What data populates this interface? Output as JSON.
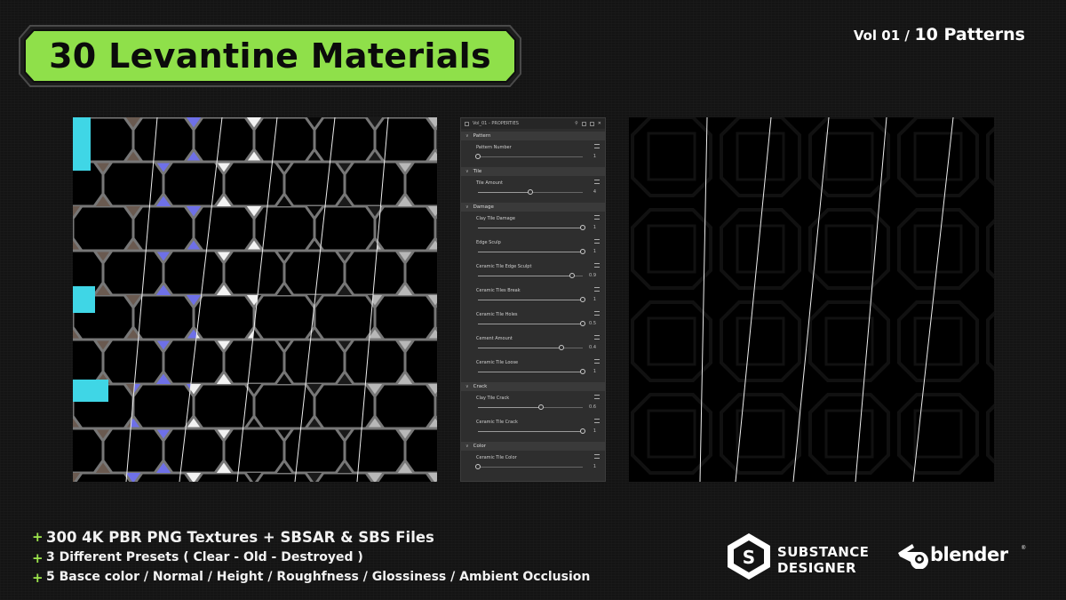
{
  "title": "30 Levantine Materials",
  "volume": {
    "vol": "Vol 01 /",
    "patterns": "10 Patterns"
  },
  "panel": {
    "header": "Vol_01 - PROPERTIES",
    "sections": [
      {
        "name": "Pattern",
        "params": [
          {
            "label": "Pattern Number",
            "value": "1",
            "level": 0.0
          }
        ]
      },
      {
        "name": "Tile",
        "params": [
          {
            "label": "Tile Amount",
            "value": "4",
            "level": 0.5
          }
        ]
      },
      {
        "name": "Damage",
        "params": [
          {
            "label": "Clay Tile Damage",
            "value": "1",
            "level": 1.0
          },
          {
            "label": "Edge Sculp",
            "value": "1",
            "level": 1.0
          },
          {
            "label": "Ceramic Tile Edge Sculpt",
            "value": "0.9",
            "level": 0.9
          },
          {
            "label": "Ceramic Tiles Break",
            "value": "1",
            "level": 1.0
          },
          {
            "label": "Ceramic Tile Holes",
            "value": "0.5",
            "level": 1.0
          },
          {
            "label": "Cement Amount",
            "value": "0.4",
            "level": 0.8
          },
          {
            "label": "Ceramic Tile Loose",
            "value": "1",
            "level": 1.0
          }
        ]
      },
      {
        "name": "Crack",
        "params": [
          {
            "label": "Clay Tile Crack",
            "value": "0.6",
            "level": 0.6
          },
          {
            "label": "Ceramic Tile Crack",
            "value": "1",
            "level": 1.0
          }
        ]
      },
      {
        "name": "Color",
        "params": [
          {
            "label": "Ceramic Tile Color",
            "value": "1",
            "level": 0.0
          }
        ]
      }
    ]
  },
  "features": [
    "300 4K PBR PNG Textures + SBSAR & SBS Files",
    "3 Different Presets ( Clear - Old - Destroyed )",
    "5 Basce color / Normal / Height / Roughfness / Glossiness / Ambient Occlusion"
  ],
  "logos": {
    "substance_line1": "SUBSTANCE",
    "substance_line2": "DESIGNER",
    "blender": "blender"
  },
  "colors": {
    "accent_green": "#9ee64c",
    "title_bg": "#8fe04a",
    "cyan": "#3fd6e6",
    "terracotta": "#b57a62",
    "normal_blue": "#7f7cf0"
  }
}
